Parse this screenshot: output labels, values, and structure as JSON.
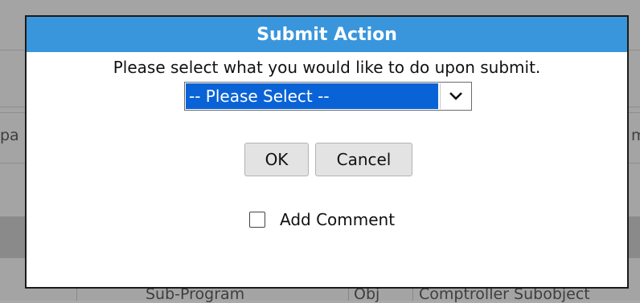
{
  "background": {
    "left_fragment": "pa",
    "right_fragment": "m",
    "bottom_columns": [
      "Sub-Program",
      "Obj",
      "Comptroller Subobject"
    ]
  },
  "dialog": {
    "title": "Submit Action",
    "prompt": "Please select what you would like to do upon submit.",
    "select": {
      "value": "-- Please Select --"
    },
    "ok_label": "OK",
    "cancel_label": "Cancel",
    "comment_label": "Add Comment",
    "comment_checked": false
  },
  "colors": {
    "title_bar": "#3a96dc",
    "selected_option": "#0a63d6",
    "overlay": "#a4a4a4"
  }
}
